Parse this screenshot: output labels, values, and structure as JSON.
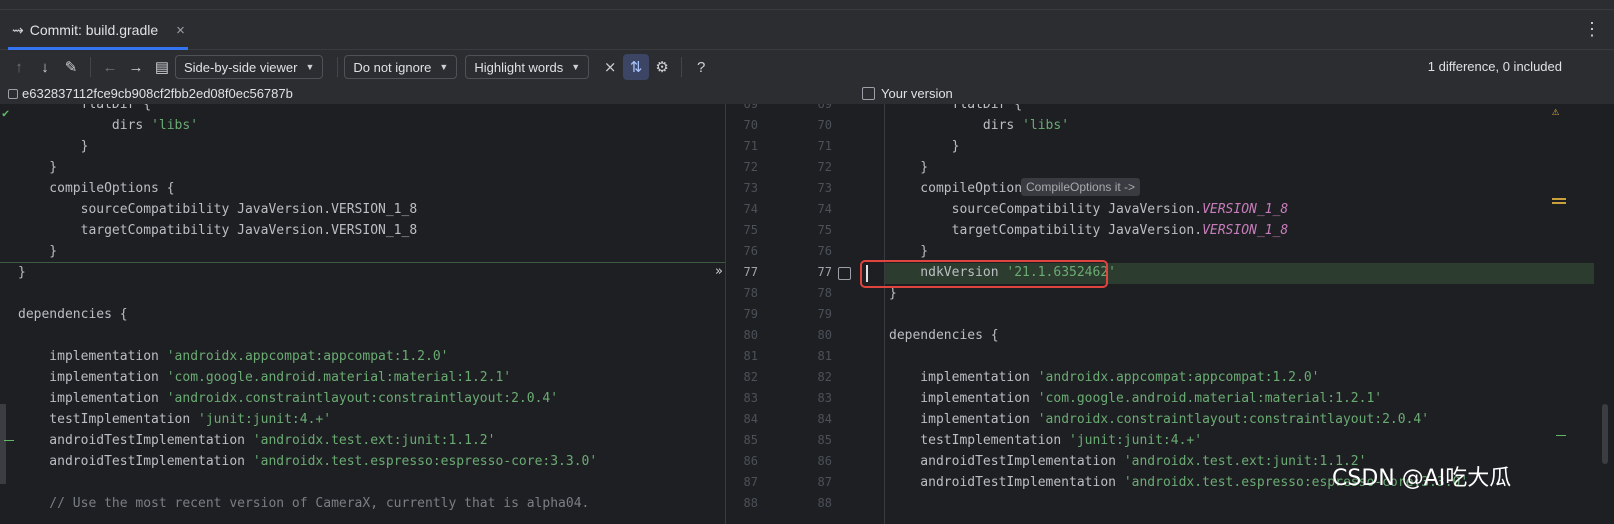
{
  "tab": {
    "title": "Commit: build.gradle",
    "close": "×"
  },
  "menu": {
    "more": "⋮"
  },
  "toolbar": {
    "viewer": "Side-by-side viewer",
    "ignore": "Do not ignore",
    "highlight": "Highlight words",
    "help": "?"
  },
  "status": "1 difference, 0 included",
  "left_header": "e632837112fce9cb908cf2fbb2ed08f0ec56787b",
  "right_header": "Your version",
  "hint": "CompileOptions it ->",
  "watermark": "CSDN @AI吃大瓜",
  "left_lines": [
    {
      "t": "        flatDir {",
      "k": "partial"
    },
    {
      "t": "            dirs ",
      "s": "'libs'"
    },
    {
      "t": "        }"
    },
    {
      "t": "    }"
    },
    {
      "t": "    compileOptions {"
    },
    {
      "t": "        sourceCompatibility JavaVersion.VERSION_1_8"
    },
    {
      "t": "        targetCompatibility JavaVersion.VERSION_1_8"
    },
    {
      "t": "    }"
    },
    {
      "t": "}"
    },
    {
      "t": ""
    },
    {
      "t": "dependencies {"
    },
    {
      "t": ""
    },
    {
      "t": "    implementation ",
      "s": "'androidx.appcompat:appcompat:1.2.0'"
    },
    {
      "t": "    implementation ",
      "s": "'com.google.android.material:material:1.2.1'"
    },
    {
      "t": "    implementation ",
      "s": "'androidx.constraintlayout:constraintlayout:2.0.4'"
    },
    {
      "t": "    testImplementation ",
      "s": "'junit:junit:4.+'"
    },
    {
      "t": "    androidTestImplementation ",
      "s": "'androidx.test.ext:junit:1.1.2'"
    },
    {
      "t": "    androidTestImplementation ",
      "s": "'androidx.test.espresso:espresso-core:3.3.0'"
    },
    {
      "t": ""
    },
    {
      "c": "    // Use the most recent version of CameraX, currently that is alpha04."
    }
  ],
  "right_lines": [
    {
      "t": "        flatDir {"
    },
    {
      "t": "            dirs ",
      "s": "'libs'"
    },
    {
      "t": "        }"
    },
    {
      "t": "    }"
    },
    {
      "t": "    compileOptions {"
    },
    {
      "t": "        sourceCompatibility JavaVersion.",
      "v": "VERSION_1_8"
    },
    {
      "t": "        targetCompatibility JavaVersion.",
      "v": "VERSION_1_8"
    },
    {
      "t": "    }"
    },
    {
      "t": "    ndkVersion ",
      "s": "'21.1.6352462'"
    },
    {
      "t": "}"
    },
    {
      "t": ""
    },
    {
      "t": "dependencies {"
    },
    {
      "t": ""
    },
    {
      "t": "    implementation ",
      "s": "'androidx.appcompat:appcompat:1.2.0'"
    },
    {
      "t": "    implementation ",
      "s": "'com.google.android.material:material:1.2.1'"
    },
    {
      "t": "    implementation ",
      "s": "'androidx.constraintlayout:constraintlayout:2.0.4'"
    },
    {
      "t": "    testImplementation ",
      "s": "'junit:junit:4.+'"
    },
    {
      "t": "    androidTestImplementation ",
      "s": "'androidx.test.ext:junit:1.1.2'"
    },
    {
      "t": "    androidTestImplementation ",
      "s": "'androidx.test.espresso:espresso-core:3.3.0'"
    },
    {
      "t": ""
    }
  ],
  "left_numbers": [
    "69",
    "70",
    "71",
    "72",
    "73",
    "74",
    "75",
    "76",
    "77",
    "78",
    "79",
    "80",
    "81",
    "82",
    "83",
    "84",
    "85",
    "86",
    "87",
    "88"
  ],
  "right_numbers": [
    "69",
    "70",
    "71",
    "72",
    "73",
    "74",
    "75",
    "76",
    "77",
    "78",
    "79",
    "80",
    "81",
    "82",
    "83",
    "84",
    "85",
    "86",
    "87",
    "88"
  ]
}
